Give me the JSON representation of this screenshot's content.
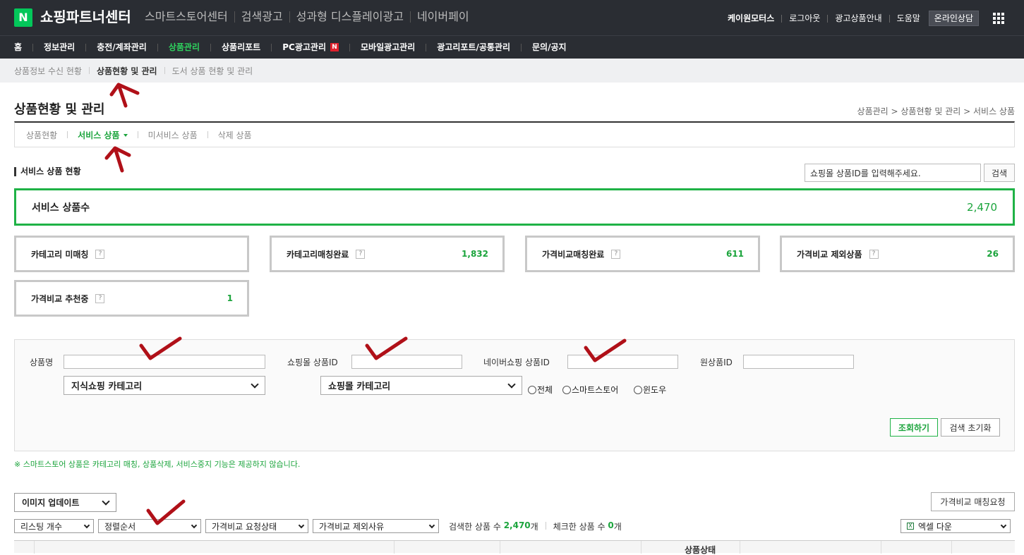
{
  "topbar": {
    "logo": "N",
    "brand": "쇼핑파트너센터",
    "links": [
      "스마트스토어센터",
      "검색광고",
      "성과형 디스플레이광고",
      "네이버페이"
    ],
    "user": "케이원모터스",
    "logout": "로그아웃",
    "ad_guide": "광고상품안내",
    "help": "도움말",
    "consult": "온라인상담"
  },
  "mainnav": {
    "items": [
      "홈",
      "정보관리",
      "충전/계좌관리",
      "상품관리",
      "상품리포트",
      "PC광고관리",
      "모바일광고관리",
      "광고리포트/공통관리",
      "문의/공지"
    ],
    "active_index": 3,
    "new_badge": "N"
  },
  "subnav": {
    "items": [
      "상품정보 수신 현황",
      "상품현황 및 관리",
      "도서 상품 현황 및 관리"
    ],
    "active_index": 1
  },
  "page": {
    "title": "상품현황 및 관리",
    "breadcrumb": "상품관리 > 상품현황 및 관리 > 서비스 상품"
  },
  "tabs": {
    "items": [
      "상품현황",
      "서비스 상품",
      "미서비스 상품",
      "삭제 상품"
    ],
    "active_index": 1
  },
  "section": {
    "title": "서비스 상품 현황",
    "search_value": "쇼핑몰 상품ID를 입력해주세요.",
    "search_button": "검색"
  },
  "total": {
    "label": "서비스 상품수",
    "value": "2,470"
  },
  "stats": [
    {
      "label": "카테고리 미매칭",
      "value": ""
    },
    {
      "label": "카테고리매칭완료",
      "value": "1,832"
    },
    {
      "label": "가격비교매칭완료",
      "value": "611"
    },
    {
      "label": "가격비교 제외상품",
      "value": "26"
    },
    {
      "label": "가격비교 추천중",
      "value": "1"
    }
  ],
  "help_mark": "?",
  "filter": {
    "labels": {
      "product_name": "상품명",
      "mall_product_id": "쇼핑몰 상품ID",
      "naver_product_id": "네이버쇼핑 상품ID",
      "original_id": "원상품ID"
    },
    "category1": "지식쇼핑 카테고리",
    "category2": "쇼핑몰 카테고리",
    "radios": [
      "전체",
      "스마트스토어",
      "윈도우"
    ],
    "search_button": "조회하기",
    "reset_button": "검색 초기화"
  },
  "notice": "※ 스마트스토어 상품은 카테고리 매칭, 상품삭제, 서비스중지 기능은 제공하지 않습니다.",
  "toolbar": {
    "image_update": "이미지 업데이트",
    "price_request": "가격비교 매칭요청",
    "listing_count": "리스팅 개수",
    "sort_order": "정렬순서",
    "price_status": "가격비교 요청상태",
    "exclude_reason": "가격비교 제외사유",
    "searched_prefix": "검색한 상품 수 ",
    "searched_count": "2,470",
    "searched_suffix": "개",
    "checked_prefix": "체크한 상품 수 ",
    "checked_count": "0",
    "checked_suffix": "개",
    "excel_icon": "X",
    "excel": "엑셀 다운"
  },
  "table": {
    "status_header": "상품상태"
  },
  "colors": {
    "green": "#1fb246",
    "dark": "#2a2d33",
    "annotation": "#b01018"
  }
}
